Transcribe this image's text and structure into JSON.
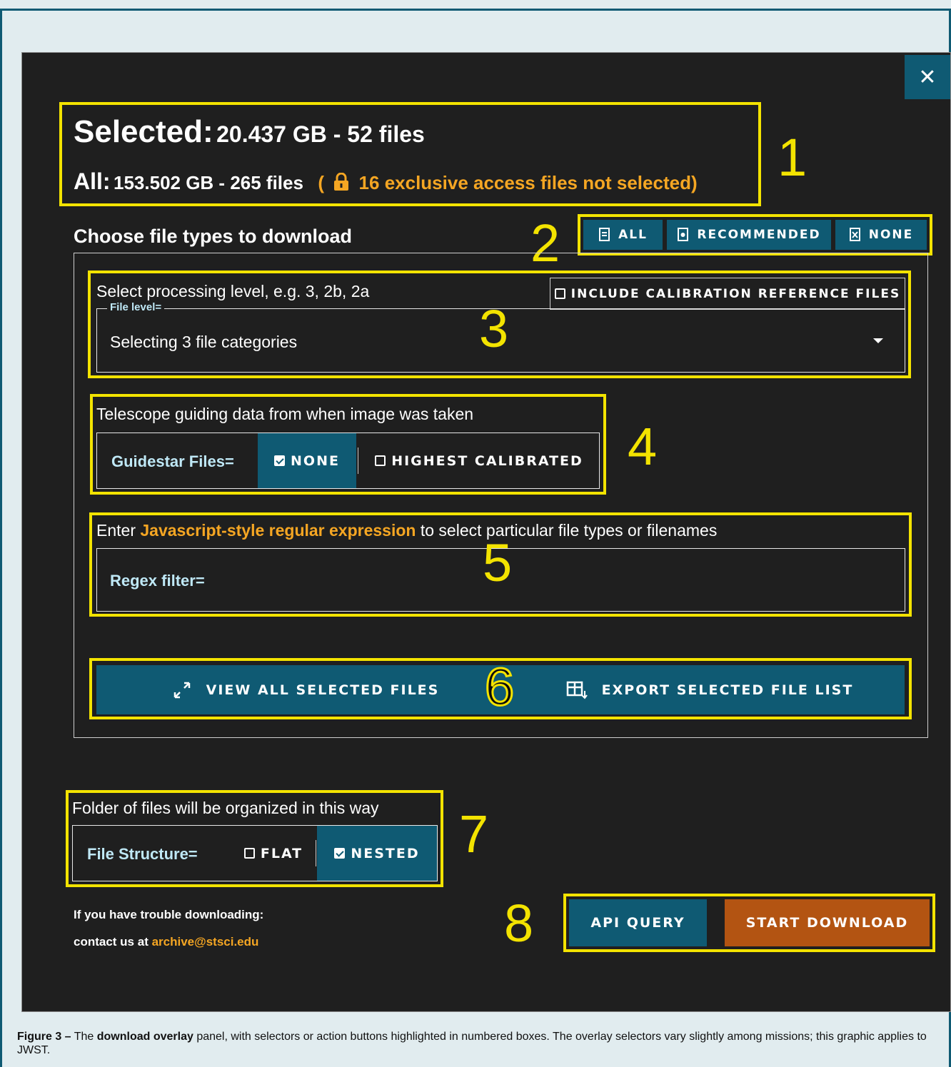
{
  "overlay": {
    "close_icon": "close-icon",
    "summary": {
      "selected_label": "Selected:",
      "selected_value": "20.437 GB - 52 files",
      "all_label": "All:",
      "all_value": "153.502 GB - 265 files",
      "paren_open": "(",
      "exclusive_note": "16 exclusive access files not selected)",
      "lock_icon": "lock-icon"
    },
    "file_types": {
      "heading": "Choose file types to download",
      "buttons": {
        "all": "ALL",
        "recommended": "RECOMMENDED",
        "none": "NONE"
      }
    },
    "processing": {
      "description": "Select processing level, e.g. 3, 2b, 2a",
      "calibration_checkbox": "INCLUDE CALIBRATION REFERENCE FILES",
      "field_legend": "File level=",
      "field_value": "Selecting 3 file categories"
    },
    "guidestar": {
      "description": "Telescope guiding data from when image was taken",
      "label": "Guidestar Files=",
      "option_none": "NONE",
      "option_highest": "HIGHEST CALIBRATED",
      "selected": "NONE"
    },
    "regex": {
      "prefix": "Enter ",
      "link": "Javascript-style regular expression",
      "suffix": " to select particular file types or filenames",
      "label": "Regex filter=",
      "value": ""
    },
    "actions": {
      "view_all": "VIEW ALL SELECTED FILES",
      "export_list": "EXPORT SELECTED FILE LIST"
    },
    "structure": {
      "description": "Folder of files will be organized in this way",
      "label": "File Structure=",
      "option_flat": "FLAT",
      "option_nested": "NESTED",
      "selected": "NESTED"
    },
    "help": {
      "line1": "If you have trouble downloading:",
      "line2_prefix": "contact us at ",
      "email": "archive@stsci.edu"
    },
    "footer_buttons": {
      "api_query": "API QUERY",
      "start_download": "START DOWNLOAD"
    }
  },
  "annotations": [
    "1",
    "2",
    "3",
    "4",
    "5",
    "6",
    "7",
    "8"
  ],
  "caption": {
    "figure": "Figure 3 –",
    "text1": " The ",
    "bold": "download overlay",
    "text2": " panel, with selectors or action buttons highlighted in numbered boxes. The overlay selectors vary slightly among missions; this graphic applies to JWST."
  },
  "colors": {
    "accent_teal": "#0f5a73",
    "highlight_yellow": "#f3e300",
    "warning_orange": "#f5a623",
    "download_orange": "#b35412",
    "panel_bg": "#1f1f1f"
  }
}
